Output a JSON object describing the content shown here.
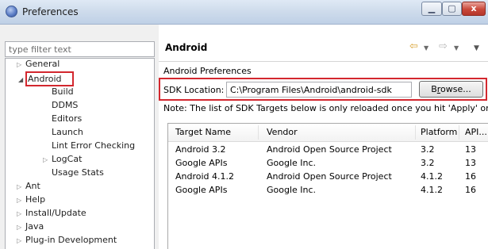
{
  "window": {
    "title": "Preferences",
    "controls": {
      "minimize": "▁",
      "maximize": "▢",
      "close": "x"
    }
  },
  "filter": {
    "placeholder": "type filter text"
  },
  "tree": {
    "items": [
      {
        "label": "General",
        "expandable": true,
        "expanded": false
      },
      {
        "label": "Android",
        "expandable": true,
        "expanded": true,
        "selected": true
      },
      {
        "label": "Build",
        "level": 2
      },
      {
        "label": "DDMS",
        "level": 2
      },
      {
        "label": "Editors",
        "level": 2
      },
      {
        "label": "Launch",
        "level": 2
      },
      {
        "label": "Lint Error Checking",
        "level": 2
      },
      {
        "label": "LogCat",
        "level": 2,
        "expandable": true
      },
      {
        "label": "Usage Stats",
        "level": 2
      },
      {
        "label": "Ant",
        "expandable": true
      },
      {
        "label": "Help",
        "expandable": true
      },
      {
        "label": "Install/Update",
        "expandable": true
      },
      {
        "label": "Java",
        "expandable": true
      },
      {
        "label": "Plug-in Development",
        "expandable": true
      }
    ]
  },
  "page": {
    "title": "Android",
    "section_title": "Android Preferences",
    "sdk_label": "SDK Location:",
    "sdk_value": "C:\\Program Files\\Android\\android-sdk",
    "browse_prefix": "B",
    "browse_underlined": "r",
    "browse_suffix": "owse...",
    "note": "Note: The list of SDK Targets below is only reloaded once you hit 'Apply' or 'OK'."
  },
  "table": {
    "columns": [
      "Target Name",
      "Vendor",
      "Platform",
      "API..."
    ],
    "rows": [
      [
        "Android 3.2",
        "Android Open Source Project",
        "3.2",
        "13"
      ],
      [
        "Google APIs",
        "Google Inc.",
        "3.2",
        "13"
      ],
      [
        "Android 4.1.2",
        "Android Open Source Project",
        "4.1.2",
        "16"
      ],
      [
        "Google APIs",
        "Google Inc.",
        "4.1.2",
        "16"
      ]
    ]
  },
  "icons": {
    "app": "eclipse-icon",
    "back": "back-arrow-icon",
    "forward": "forward-arrow-icon",
    "view_menu": "view-menu-icon",
    "collapsed": "tree-collapsed-icon",
    "expanded": "tree-expanded-icon"
  },
  "colors": {
    "highlight": "#d3272e",
    "title_bar": "#cfdcec"
  }
}
